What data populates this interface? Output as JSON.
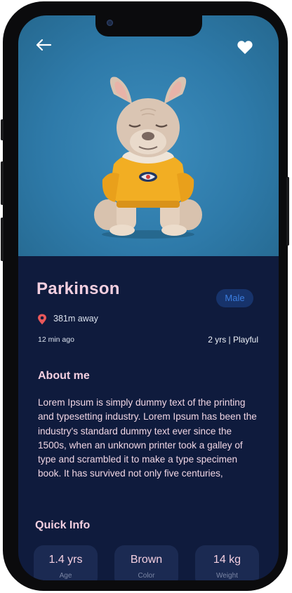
{
  "pet": {
    "name": "Parkinson",
    "gender": "Male",
    "distance": "381m away",
    "posted": "12 min ago",
    "age_trait": "2 yrs | Playful"
  },
  "about": {
    "heading": "About me",
    "text": "Lorem Ipsum is simply dummy text of the printing and typesetting industry. Lorem Ipsum has been the industry's standard dummy text ever since the 1500s, when an unknown printer took a galley of type and scrambled it to make a type specimen book. It has survived not only five centuries,"
  },
  "quick_info": {
    "heading": "Quick Info",
    "items": [
      {
        "value": "1.4 yrs",
        "label": "Age"
      },
      {
        "value": "Brown",
        "label": "Color"
      },
      {
        "value": "14 kg",
        "label": "Weight"
      }
    ]
  },
  "icons": {
    "back": "arrow-left-icon",
    "favorite": "heart-icon",
    "location": "location-pin-icon"
  },
  "colors": {
    "background": "#0f1b3d",
    "photo_backdrop": "#2e7aa9",
    "accent_text": "#f3cfe0",
    "badge_bg": "#17336b",
    "badge_text": "#3b7de0",
    "pin": "#e8585a"
  }
}
